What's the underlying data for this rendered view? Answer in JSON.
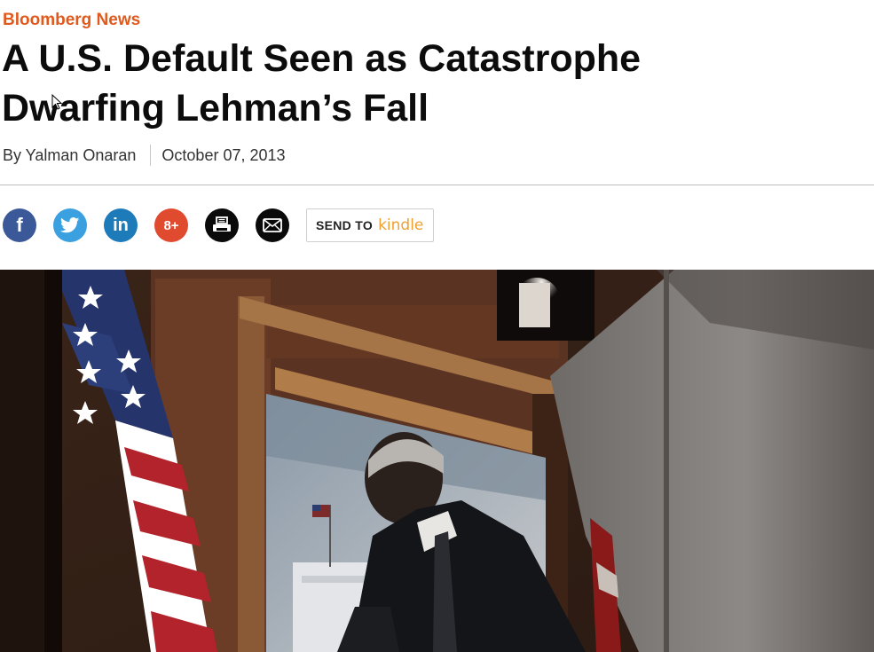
{
  "article": {
    "kicker": "Bloomberg News",
    "headline_line1": "A U.S. Default Seen as Catastrophe",
    "headline_line2": "Dwarfing Lehman’s Fall",
    "byline": "By Yalman Onaran",
    "date": "October 07, 2013"
  },
  "share": {
    "facebook_glyph": "f",
    "linkedin_glyph": "in",
    "googleplus_glyph": "8+",
    "send_to_label": "SEND TO",
    "kindle_label": "kindle",
    "icons": [
      "facebook-icon",
      "twitter-icon",
      "linkedin-icon",
      "google-plus-icon",
      "print-icon",
      "email-icon"
    ]
  },
  "colors": {
    "kicker": "#e05a1e",
    "facebook": "#3b5998",
    "twitter": "#3aa0e0",
    "linkedin": "#1d7bb9",
    "googleplus": "#e04a2f",
    "kindle": "#f0a030"
  }
}
